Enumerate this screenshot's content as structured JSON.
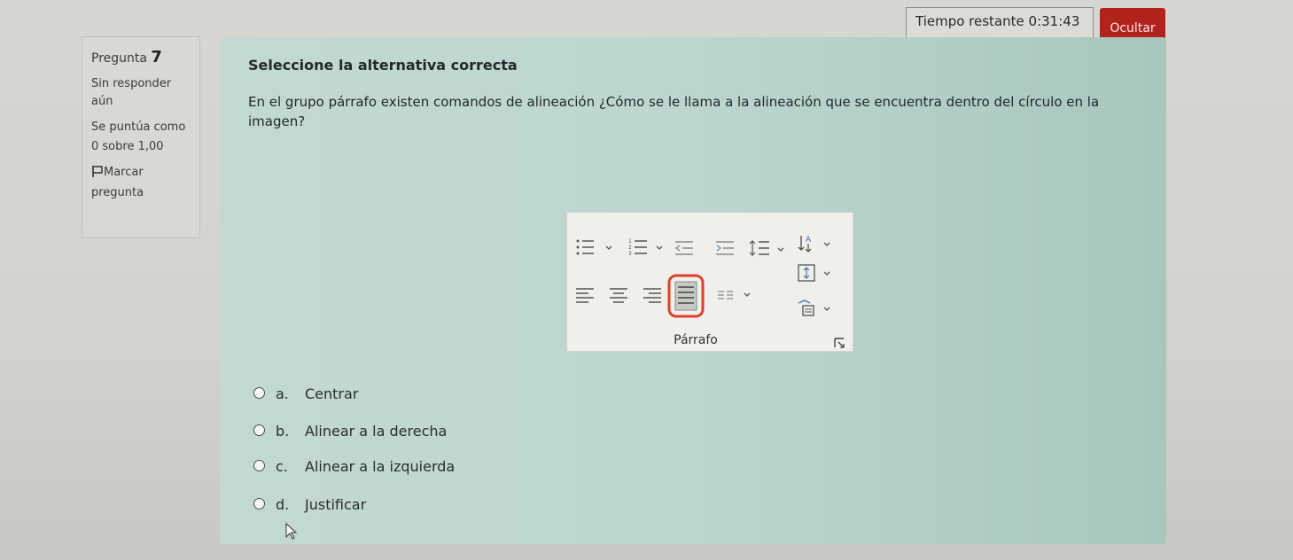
{
  "timer": {
    "label": "Tiempo restante",
    "value": "0:31:43"
  },
  "hide_button": "Ocultar",
  "info": {
    "question_label": "Pregunta",
    "question_number": "7",
    "status": "Sin responder aún",
    "score": "Se puntúa como 0 sobre 1,00",
    "flag_label": "Marcar pregunta"
  },
  "question": {
    "title": "Seleccione la alternativa correcta",
    "text": "En el grupo párrafo existen comandos de alineación ¿Cómo se le llama a la alineación que se encuentra dentro del círculo en la imagen?"
  },
  "ribbon": {
    "label": "Párrafo",
    "icons": [
      "bullets-icon",
      "numbering-icon",
      "decrease-indent-icon",
      "increase-indent-icon",
      "line-spacing-icon",
      "sort-icon",
      "align-left-icon",
      "align-center-icon",
      "align-right-icon",
      "justify-icon",
      "columns-icon",
      "spacing-icon",
      "shading-icon",
      "dialog-launcher-icon"
    ],
    "highlight_color": "#e0402a"
  },
  "options": [
    {
      "letter": "a.",
      "text": "Centrar"
    },
    {
      "letter": "b.",
      "text": "Alinear a la derecha"
    },
    {
      "letter": "c.",
      "text": "Alinear a la izquierda"
    },
    {
      "letter": "d.",
      "text": "Justificar"
    }
  ],
  "colors": {
    "hide_button": "#b3231d",
    "panel": "#bcd6cf"
  }
}
